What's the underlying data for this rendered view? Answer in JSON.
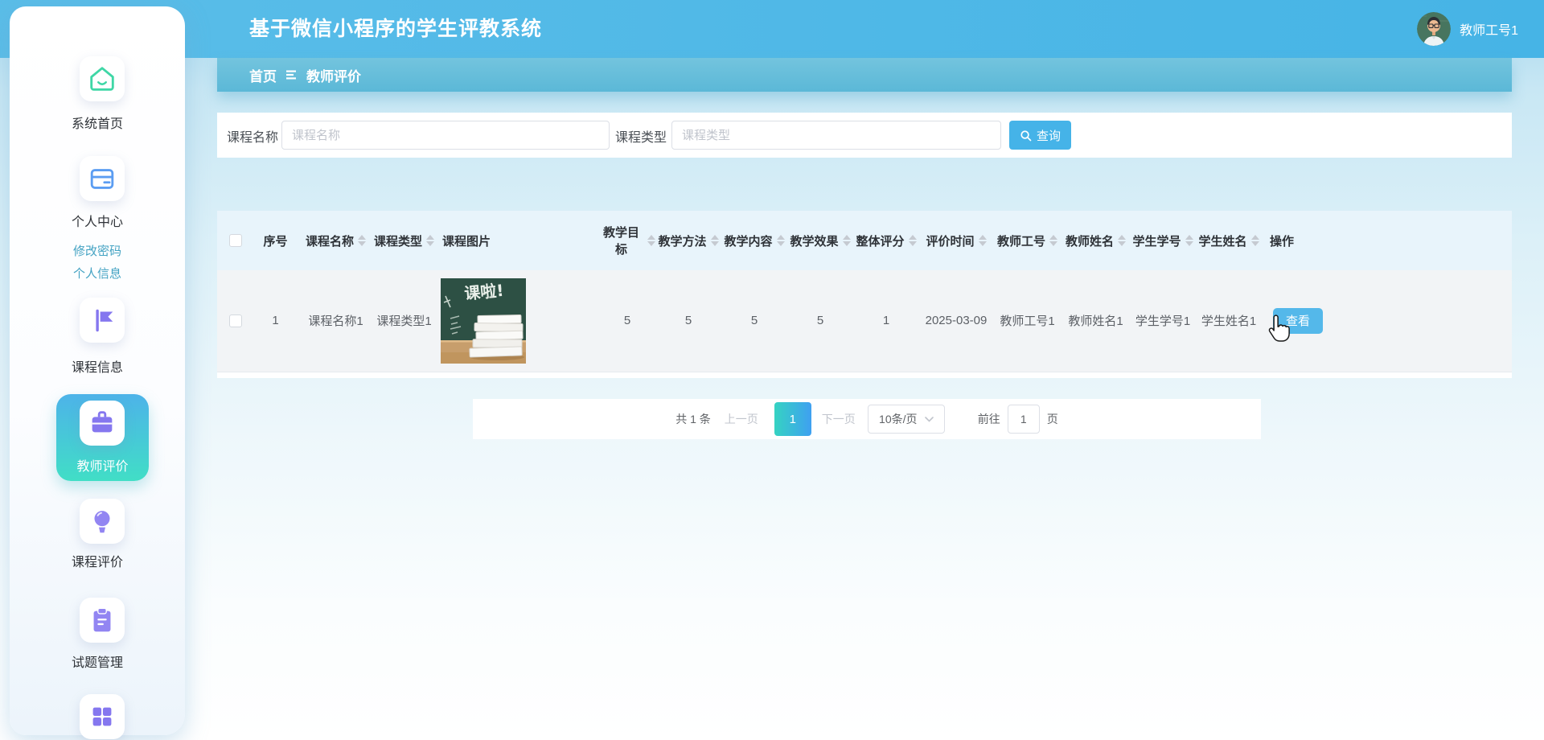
{
  "header": {
    "title": "基于微信小程序的学生评教系统",
    "user_name": "教师工号1"
  },
  "breadcrumb": {
    "home": "首页",
    "current": "教师评价"
  },
  "sidebar": {
    "items": [
      {
        "id": "home",
        "label": "系统首页",
        "icon": "home-icon"
      },
      {
        "id": "profile",
        "label": "个人中心",
        "icon": "card-icon",
        "children": [
          {
            "label": "修改密码"
          },
          {
            "label": "个人信息"
          }
        ]
      },
      {
        "id": "course-info",
        "label": "课程信息",
        "icon": "flag-icon"
      },
      {
        "id": "teacher-eval",
        "label": "教师评价",
        "icon": "briefcase-icon",
        "active": true
      },
      {
        "id": "course-eval",
        "label": "课程评价",
        "icon": "bulb-icon"
      },
      {
        "id": "question-mgmt",
        "label": "试题管理",
        "icon": "clipboard-icon"
      },
      {
        "id": "more",
        "label": "",
        "icon": "grid-icon"
      }
    ]
  },
  "search": {
    "name_label": "课程名称",
    "name_placeholder": "课程名称",
    "type_label": "课程类型",
    "type_placeholder": "课程类型",
    "query_button": "查询"
  },
  "table": {
    "columns": [
      {
        "key": "select",
        "label": "",
        "sortable": false
      },
      {
        "key": "index",
        "label": "序号",
        "sortable": false
      },
      {
        "key": "course_name",
        "label": "课程名称",
        "sortable": true
      },
      {
        "key": "course_type",
        "label": "课程类型",
        "sortable": true
      },
      {
        "key": "course_image",
        "label": "课程图片",
        "sortable": false
      },
      {
        "key": "teaching_goal",
        "label": "教学目标",
        "sortable": true
      },
      {
        "key": "teaching_method",
        "label": "教学方法",
        "sortable": true
      },
      {
        "key": "teaching_content",
        "label": "教学内容",
        "sortable": true
      },
      {
        "key": "teaching_effect",
        "label": "教学效果",
        "sortable": true
      },
      {
        "key": "overall_score",
        "label": "整体评分",
        "sortable": true
      },
      {
        "key": "eval_time",
        "label": "评价时间",
        "sortable": true
      },
      {
        "key": "teacher_id",
        "label": "教师工号",
        "sortable": true
      },
      {
        "key": "teacher_name",
        "label": "教师姓名",
        "sortable": true
      },
      {
        "key": "student_id",
        "label": "学生学号",
        "sortable": true
      },
      {
        "key": "student_name",
        "label": "学生姓名",
        "sortable": true
      },
      {
        "key": "action",
        "label": "操作",
        "sortable": false
      }
    ],
    "rows": [
      {
        "index": "1",
        "course_name": "课程名称1",
        "course_type": "课程类型1",
        "course_image_text": "课啦!",
        "teaching_goal": "5",
        "teaching_method": "5",
        "teaching_content": "5",
        "teaching_effect": "5",
        "overall_score": "1",
        "eval_time": "2025-03-09",
        "teacher_id": "教师工号1",
        "teacher_name": "教师姓名1",
        "student_id": "学生学号1",
        "student_name": "学生姓名1",
        "action_label": "查看"
      }
    ]
  },
  "pagination": {
    "total_text": "共 1 条",
    "prev_label": "上一页",
    "active_page": "1",
    "next_label": "下一页",
    "page_size_label": "10条/页",
    "goto_label": "前往",
    "goto_value": "1",
    "page_unit": "页"
  },
  "colors": {
    "topband": "#4fb9e7",
    "breadcrumb": "#63bdda",
    "accent_button": "#45b3e8",
    "active_nav_top": "#4db3e9",
    "active_nav_bottom": "#41dec6",
    "pagination_active_left": "#35d3c2",
    "pagination_active_right": "#3fa0f1",
    "table_header_bg": "#e8f4fb",
    "row_bg": "#f2f4f6"
  }
}
